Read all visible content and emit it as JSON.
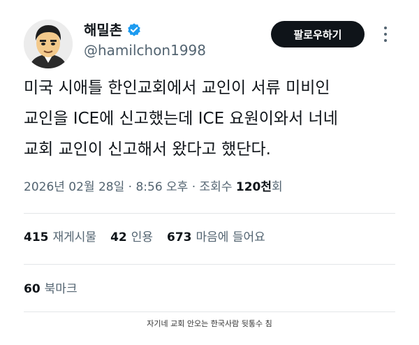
{
  "author": {
    "display_name": "해밀촌",
    "handle": "@hamilchon1998",
    "verified_icon": "verified-badge-icon",
    "badge_color": "#1d9bf0"
  },
  "follow_button": {
    "label": "팔로우하기"
  },
  "more_button": {
    "icon": "more-dots-icon"
  },
  "tweet": {
    "text_lines": [
      "미국 시애틀 한인교회에서 교인이 서류 미비인",
      "교인을 ICE에 신고했는데 ICE 요원이와서 너네",
      "교회 교인이 신고해서 왔다고 했단다."
    ]
  },
  "meta": {
    "timestamp": "2026년 02월 28일 · 8:56 오후",
    "separator": " · ",
    "views_label": "조회수 ",
    "views_count": "120천",
    "views_suffix": "회"
  },
  "stats": {
    "reposts": {
      "count": "415",
      "label": "재게시물"
    },
    "quotes": {
      "count": "42",
      "label": "인용"
    },
    "likes": {
      "count": "673",
      "label": "마음에 들어요"
    }
  },
  "bookmarks": {
    "count": "60",
    "label": "북마크"
  },
  "caption": "자기네 교회 안오는 한국사람 뒷통수 침"
}
